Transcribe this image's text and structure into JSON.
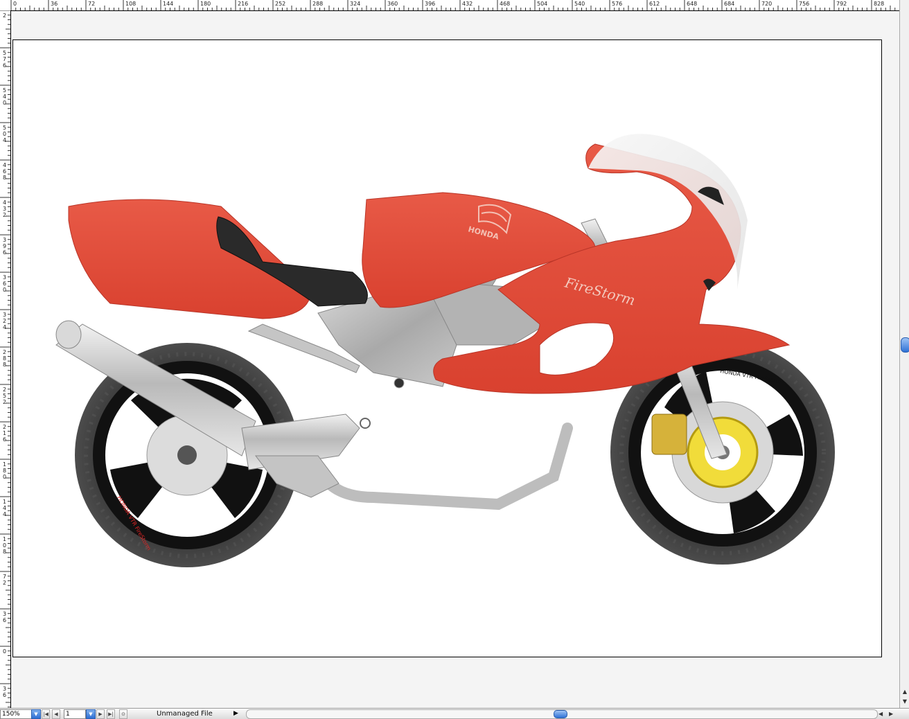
{
  "ruler": {
    "top_labels": [
      "0",
      "36",
      "72",
      "108",
      "144",
      "180",
      "216",
      "252",
      "288",
      "324",
      "360",
      "396",
      "432",
      "468",
      "504",
      "540",
      "576",
      "612",
      "648",
      "684",
      "720",
      "756",
      "792",
      "828"
    ],
    "left_labels": [
      "2",
      "576",
      "540",
      "504",
      "468",
      "432",
      "396",
      "360",
      "324",
      "288",
      "252",
      "216",
      "180",
      "144",
      "108",
      "72",
      "36",
      "0",
      "36"
    ]
  },
  "artwork": {
    "tank_logo": "HONDA",
    "fairing_script": "FireStorm",
    "front_tire_text": "HONDA  VTR FireStorm",
    "rear_tire_text": "HONDA  VTR FireStorm"
  },
  "statusbar": {
    "zoom": "150%",
    "page": "1",
    "file_status": "Unmanaged File"
  },
  "colors": {
    "body_red": "#e04a3a",
    "seat_black": "#2a2a2a",
    "chrome": "#c8c8c8",
    "caliper_gold": "#d6b23a",
    "rotor_yellow": "#f1dc3a"
  }
}
